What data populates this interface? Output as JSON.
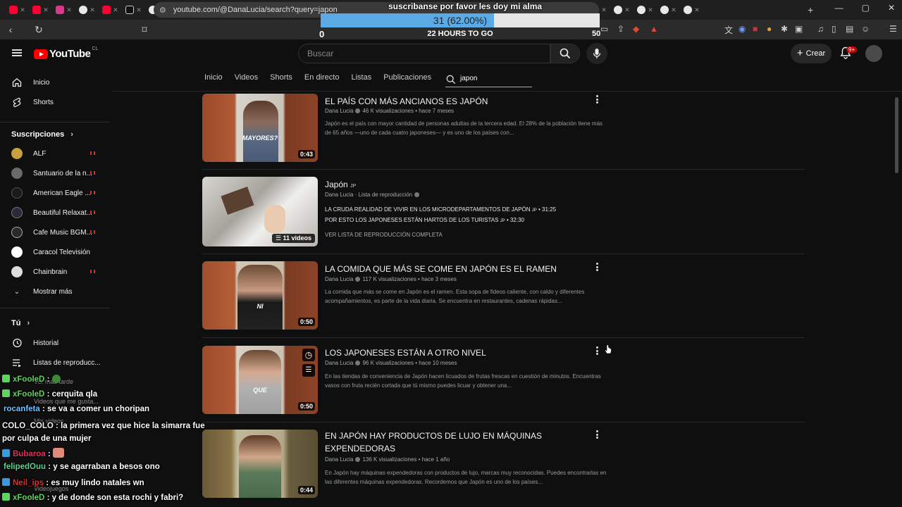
{
  "browser": {
    "url": "youtube.com/@DanaLucia/search?query=japon",
    "tabs_count": 34,
    "new_tab": "+",
    "window_controls": [
      "—",
      "▢",
      "✕"
    ]
  },
  "stream_overlay": {
    "title": "suscribanse por favor les doy mi alma",
    "goal_text": "31 (62.00%)",
    "goal_fraction": 0.62,
    "goal_min": "0",
    "goal_max": "50",
    "goal_sub": "22 HOURS TO GO"
  },
  "youtube": {
    "logo_word": "YouTube",
    "logo_country": "CL",
    "search_placeholder": "Buscar",
    "create_label": "Crear",
    "notif_badge": "9+"
  },
  "sidebar": {
    "main": [
      {
        "label": "Inicio",
        "icon": "home-icon"
      },
      {
        "label": "Shorts",
        "icon": "shorts-icon"
      }
    ],
    "subs_heading": "Suscripciones",
    "subs": [
      {
        "label": "ALF",
        "color": "#c8a040"
      },
      {
        "label": "Santuario de la n...",
        "color": "#6a6a6a"
      },
      {
        "label": "American Eagle ...",
        "color": "#1a1a1a"
      },
      {
        "label": "Beautiful Relaxat...",
        "color": "#2a2a3a"
      },
      {
        "label": "Cafe Music BGM...",
        "color": "#2a2a2a"
      },
      {
        "label": "Caracol Televisión",
        "color": "#ffffff"
      },
      {
        "label": "Chainbrain",
        "color": "#dddddd"
      }
    ],
    "show_more": "Mostrar más",
    "you_heading": "Tú",
    "you": [
      {
        "label": "Historial",
        "icon": "history-icon"
      },
      {
        "label": "Listas de reproducc...",
        "icon": "playlist-icon"
      }
    ]
  },
  "channel_tabs": [
    "Inicio",
    "Videos",
    "Shorts",
    "En directo",
    "Listas",
    "Publicaciones"
  ],
  "channel_search_value": "japon",
  "videos": [
    {
      "title": "EL PAÍS CON MÁS ANCIANOS ES JAPÓN",
      "channel": "Dana Lucia",
      "stats": "46 K visualizaciones • hace 7 meses",
      "desc": "Japón es el país con mayor cantidad de personas adultas de la tercera edad. El 28% de la población tiene más de 65 años —uno de cada cuatro japoneses— y es uno de los países con...",
      "duration": "0:43",
      "caption": "MAYORES?"
    },
    {
      "title": "EN JAPÓN HAY PRODUCTOS DE LUJO EN MÁQUINAS EXPENDEDORAS",
      "channel": "Dana Lucia",
      "stats": "136 K visualizaciones • hace 1 año",
      "desc": "En Japón hay máquinas expendedoras con productos de lujo, marcas muy reconocidas. Puedes encontrarlas en las diferentes máquinas expendedoras. Recordemos que Japón es uno de los países...",
      "duration": "0:44",
      "caption": ""
    }
  ],
  "playlist": {
    "title": "Japón",
    "flag": "JP",
    "channel": "Dana Lucia",
    "kind": "Lista de reproducción",
    "item1": "LA CRUDA REALIDAD DE VIVIR EN LOS MICRODEPARTAMENTOS DE JAPÓN",
    "item1_flag": "JP",
    "item1_dur": "• 31:25",
    "item2": "POR ESTO LOS JAPONESES ESTÁN HARTOS DE LOS TURISTAS",
    "item2_flag": "JP",
    "item2_dur": "• 32:30",
    "view_full": "VER LISTA DE REPRODUCCIÓN COMPLETA",
    "count": "11 videos"
  },
  "video3": {
    "title": "LA COMIDA QUE MÁS SE COME EN JAPÓN ES EL RAMEN",
    "channel": "Dana Lucia",
    "stats": "117 K visualizaciones • hace 3 meses",
    "desc": "La comida que más se come en Japón es el ramen. Esta sopa de fideos caliente, con caldo y diferentes acompañamientos, es parte de la vida diaria. Se encuentra en restaurantes, cadenas rápidas...",
    "duration": "0:50",
    "caption": "NI"
  },
  "video4": {
    "title": "LOS JAPONESES ESTÁN A OTRO NIVEL",
    "channel": "Dana Lucia",
    "stats": "96 K visualizaciones • hace 10 meses",
    "desc": "En las tiendas de conveniencia de Japón hacen licuados de frutas frescas en cuestión de minutos. Encuentras vasos con fruta recién cortada que tú mismo puedes licuar y obtener una...",
    "duration": "0:50",
    "caption": "QUE"
  },
  "chat": [
    {
      "user": "xFooleD",
      "color": "#5fd35f",
      "msg": " :",
      "emote": true
    },
    {
      "user": "xFooleD",
      "color": "#5fd35f",
      "msg": " : cerquita qla"
    },
    {
      "user": "rocanfeta",
      "color": "#6fc0ff",
      "msg": " : se va a comer un choripan"
    },
    {
      "user": "COLO_COLO",
      "color": "#f0f0f0",
      "msg": " : la primera vez que hice la simarra fue por culpa de una mujer"
    },
    {
      "user": "Bubaroa",
      "color": "#e0305a",
      "msg": " : "
    },
    {
      "user": "felipedOuu",
      "color": "#60d090",
      "msg": " : y se agarraban a besos ono"
    },
    {
      "user": "Neil_ips",
      "color": "#e03030",
      "msg": " : es muy lindo natales wn"
    },
    {
      "user": "xFooleD",
      "color": "#5fd35f",
      "msg": " : y de donde son esta rochi y fabri?"
    }
  ],
  "sidebar_hidden": [
    "Ver más tarde",
    "Videos que me gusta...",
    "Mis videos",
    "Videojuegos"
  ]
}
